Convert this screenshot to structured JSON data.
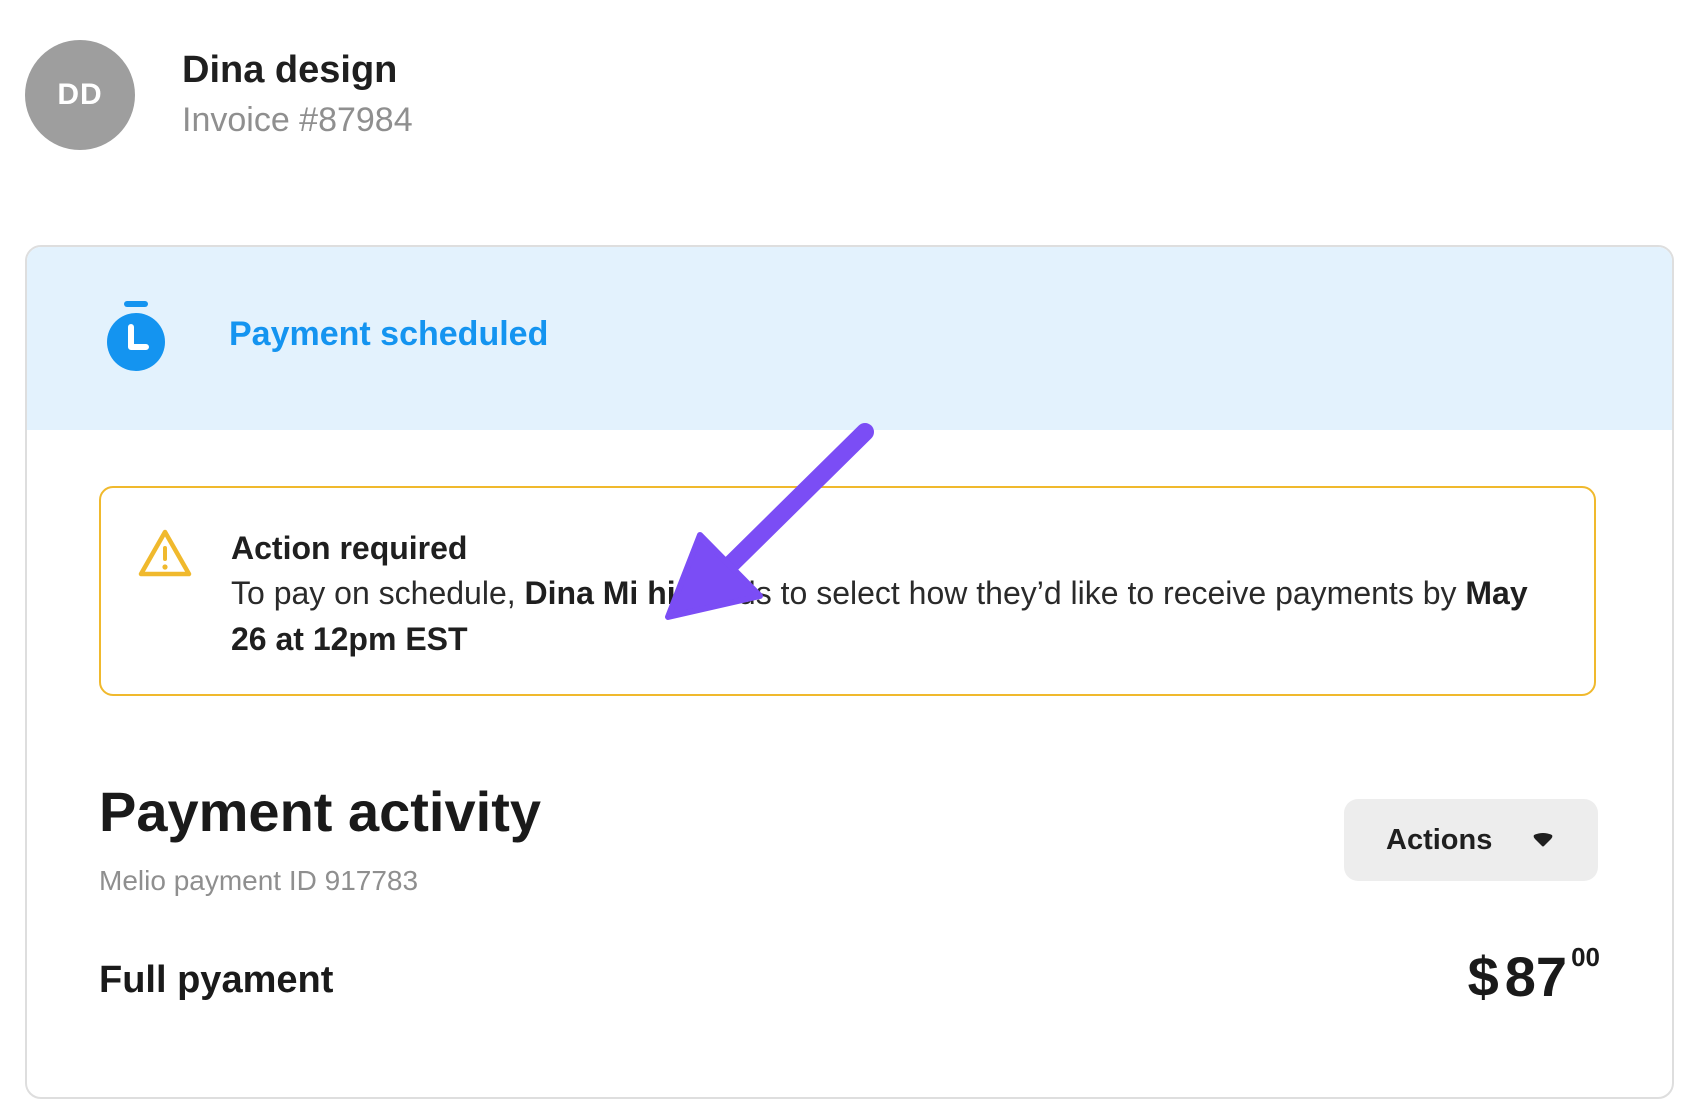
{
  "header": {
    "avatar_initials": "DD",
    "vendor_name": "Dina design",
    "invoice_number": "Invoice #87984"
  },
  "status": {
    "label": "Payment scheduled",
    "icon": "stopwatch-icon",
    "color": "#1494f0",
    "background": "#e3f2fd"
  },
  "alert": {
    "icon": "warning-icon",
    "title": "Action required",
    "message_prefix": "To pay on schedule,",
    "payee_name": "Dina Mi   hi",
    "message_middle": "needs to select how they’d like to receive payments by",
    "deadline": "May 26 at 12pm EST",
    "border_color": "#f0b92d"
  },
  "activity": {
    "title": "Payment activity",
    "payment_id": "Melio payment ID 917783",
    "actions_label": "Actions",
    "actions_icon": "caret-down-icon",
    "payment_type": "Full pyament",
    "amount_currency": "$",
    "amount_whole": "87",
    "amount_cents": "00"
  },
  "annotation": {
    "color": "#7b4df5",
    "icon": "arrow-annotation-icon"
  }
}
